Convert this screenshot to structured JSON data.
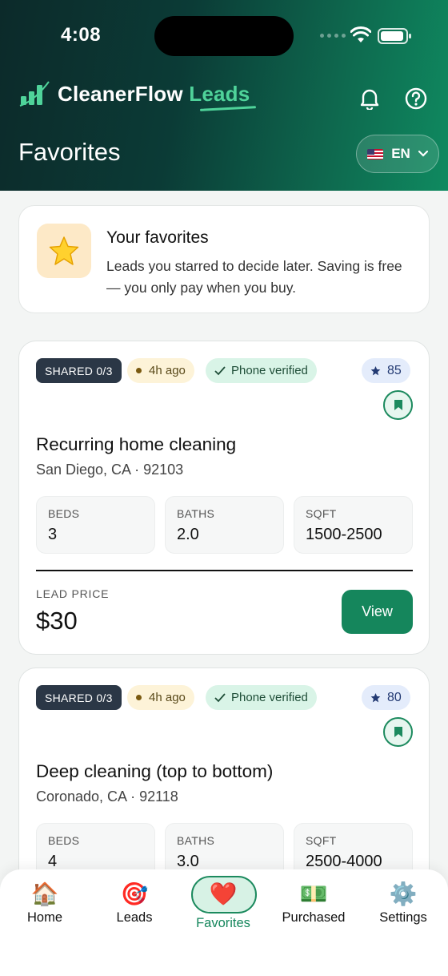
{
  "status_bar": {
    "time": "4:08"
  },
  "app": {
    "name_main": "CleanerFlow",
    "name_accent": "Leads"
  },
  "header": {
    "title": "Favorites",
    "language": "EN",
    "language_flag": "us-flag-icon"
  },
  "info": {
    "title": "Your favorites",
    "description": "Leads you starred to decide later. Saving is free — you only pay when you buy."
  },
  "leads": [
    {
      "shared": "SHARED 0/3",
      "time": "4h ago",
      "verified": "Phone verified",
      "score": "85",
      "title": "Recurring home cleaning",
      "location": "San Diego, CA · 92103",
      "beds_label": "BEDS",
      "beds": "3",
      "baths_label": "BATHS",
      "baths": "2.0",
      "sqft_label": "SQFT",
      "sqft": "1500-2500",
      "price_label": "LEAD PRICE",
      "price": "$30",
      "view_label": "View"
    },
    {
      "shared": "SHARED 0/3",
      "time": "4h ago",
      "verified": "Phone verified",
      "score": "80",
      "title": "Deep cleaning (top to bottom)",
      "location": "Coronado, CA · 92118",
      "beds_label": "BEDS",
      "beds": "4",
      "baths_label": "BATHS",
      "baths": "3.0",
      "sqft_label": "SQFT",
      "sqft": "2500-4000"
    }
  ],
  "nav": {
    "home": {
      "label": "Home",
      "icon": "🏠"
    },
    "leads": {
      "label": "Leads",
      "icon": "🎯"
    },
    "favorites": {
      "label": "Favorites",
      "icon": "❤️"
    },
    "purchased": {
      "label": "Purchased",
      "icon": "💵"
    },
    "settings": {
      "label": "Settings",
      "icon": "⚙️"
    }
  },
  "colors": {
    "brand": "#15865c",
    "accent": "#4fd39a",
    "header_dark": "#0c2a2a"
  }
}
